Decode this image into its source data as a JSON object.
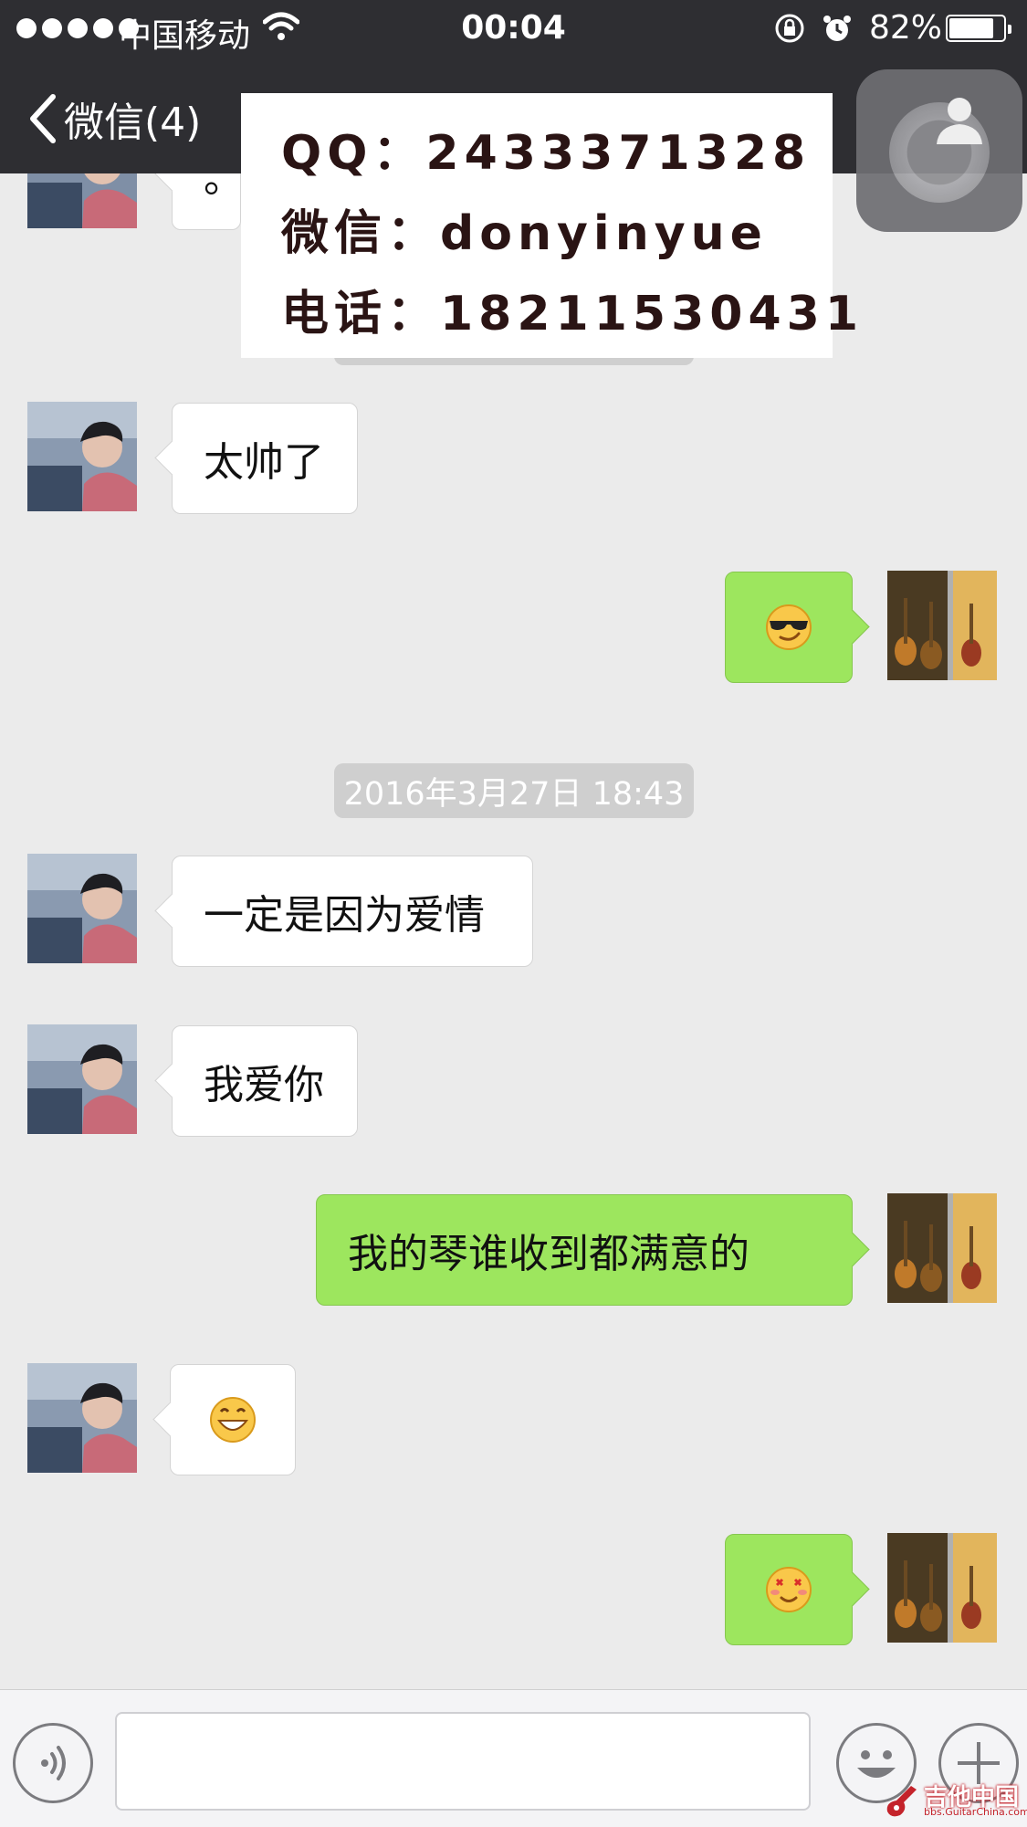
{
  "status_bar": {
    "carrier": "中国移动",
    "time": "00:04",
    "battery": "82%",
    "battery_level": 0.82
  },
  "nav": {
    "back_label": "微信(4)"
  },
  "contact_card": {
    "qq": "QQ：2433371328",
    "wechat": "微信：donyinyue",
    "phone": "电话：18211530431"
  },
  "chat": {
    "partial_message": "。",
    "timestamp": "2016年3月27日 18:43",
    "messages": [
      {
        "side": "in",
        "text": "太帅了"
      },
      {
        "side": "out",
        "emoji": "cool-sunglasses-emoji"
      },
      {
        "side": "in",
        "text": "一定是因为爱情"
      },
      {
        "side": "in",
        "text": "我爱你"
      },
      {
        "side": "out",
        "text": "我的琴谁收到都满意的"
      },
      {
        "side": "in",
        "emoji": "grin-emoji"
      },
      {
        "side": "out",
        "emoji": "heart-eyes-smile-emoji"
      }
    ]
  },
  "input_bar": {
    "voice_icon": "voice-icon",
    "emoji_icon": "smiley-icon",
    "plus_icon": "plus-icon"
  },
  "watermark": {
    "text": "吉他中国",
    "subtext": "bbs.GuitarChina.com"
  },
  "colors": {
    "nav_bg": "#2e2e32",
    "chat_bg": "#ebebeb",
    "outgoing_bubble": "#9de65e",
    "incoming_bubble": "#ffffff"
  }
}
